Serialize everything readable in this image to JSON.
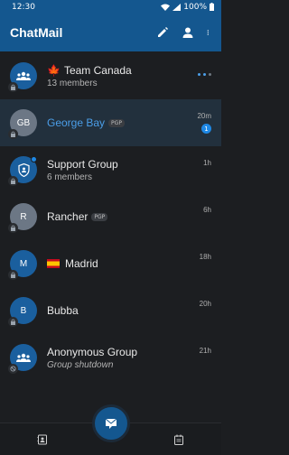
{
  "status_bar": {
    "time": "12:30",
    "battery": "100%"
  },
  "app": {
    "title": "ChatMail"
  },
  "conversations": [
    {
      "name": "Team Canada",
      "flag": "🍁",
      "subtitle": "13 members",
      "time": "",
      "typing": true,
      "avatar_text": "",
      "avatar_icon": "group-icon",
      "avatar_color": "#1a5f9e",
      "pgp": ""
    },
    {
      "name": "George Bay",
      "flag": "",
      "subtitle": "",
      "time": "20m",
      "unread": "1",
      "avatar_text": "GB",
      "avatar_color": "#6c7785",
      "pgp": "PGP",
      "highlight": true
    },
    {
      "name": "Support Group",
      "flag": "",
      "subtitle": "6 members",
      "time": "1h",
      "avatar_text": "",
      "avatar_icon": "shield-icon",
      "avatar_color": "#1a5f9e",
      "pgp": ""
    },
    {
      "name": "Rancher",
      "flag": "",
      "subtitle": "",
      "time": "6h",
      "avatar_text": "R",
      "avatar_color": "#6c7785",
      "pgp": "PGP"
    },
    {
      "name": "Madrid",
      "flag": "🇪🇸",
      "subtitle": "",
      "time": "18h",
      "avatar_text": "M",
      "avatar_color": "#1a5f9e",
      "pgp": ""
    },
    {
      "name": "Bubba",
      "flag": "",
      "subtitle": "",
      "time": "20h",
      "avatar_text": "B",
      "avatar_color": "#1a5f9e",
      "pgp": ""
    },
    {
      "name": "Anonymous Group",
      "flag": "",
      "subtitle": "Group shutdown",
      "time": "21h",
      "avatar_text": "",
      "avatar_icon": "group-icon",
      "avatar_color": "#1a5f9e",
      "pgp": ""
    }
  ],
  "colors": {
    "primary": "#14578f",
    "accent": "#1e88e5",
    "background": "#1c1e21"
  }
}
